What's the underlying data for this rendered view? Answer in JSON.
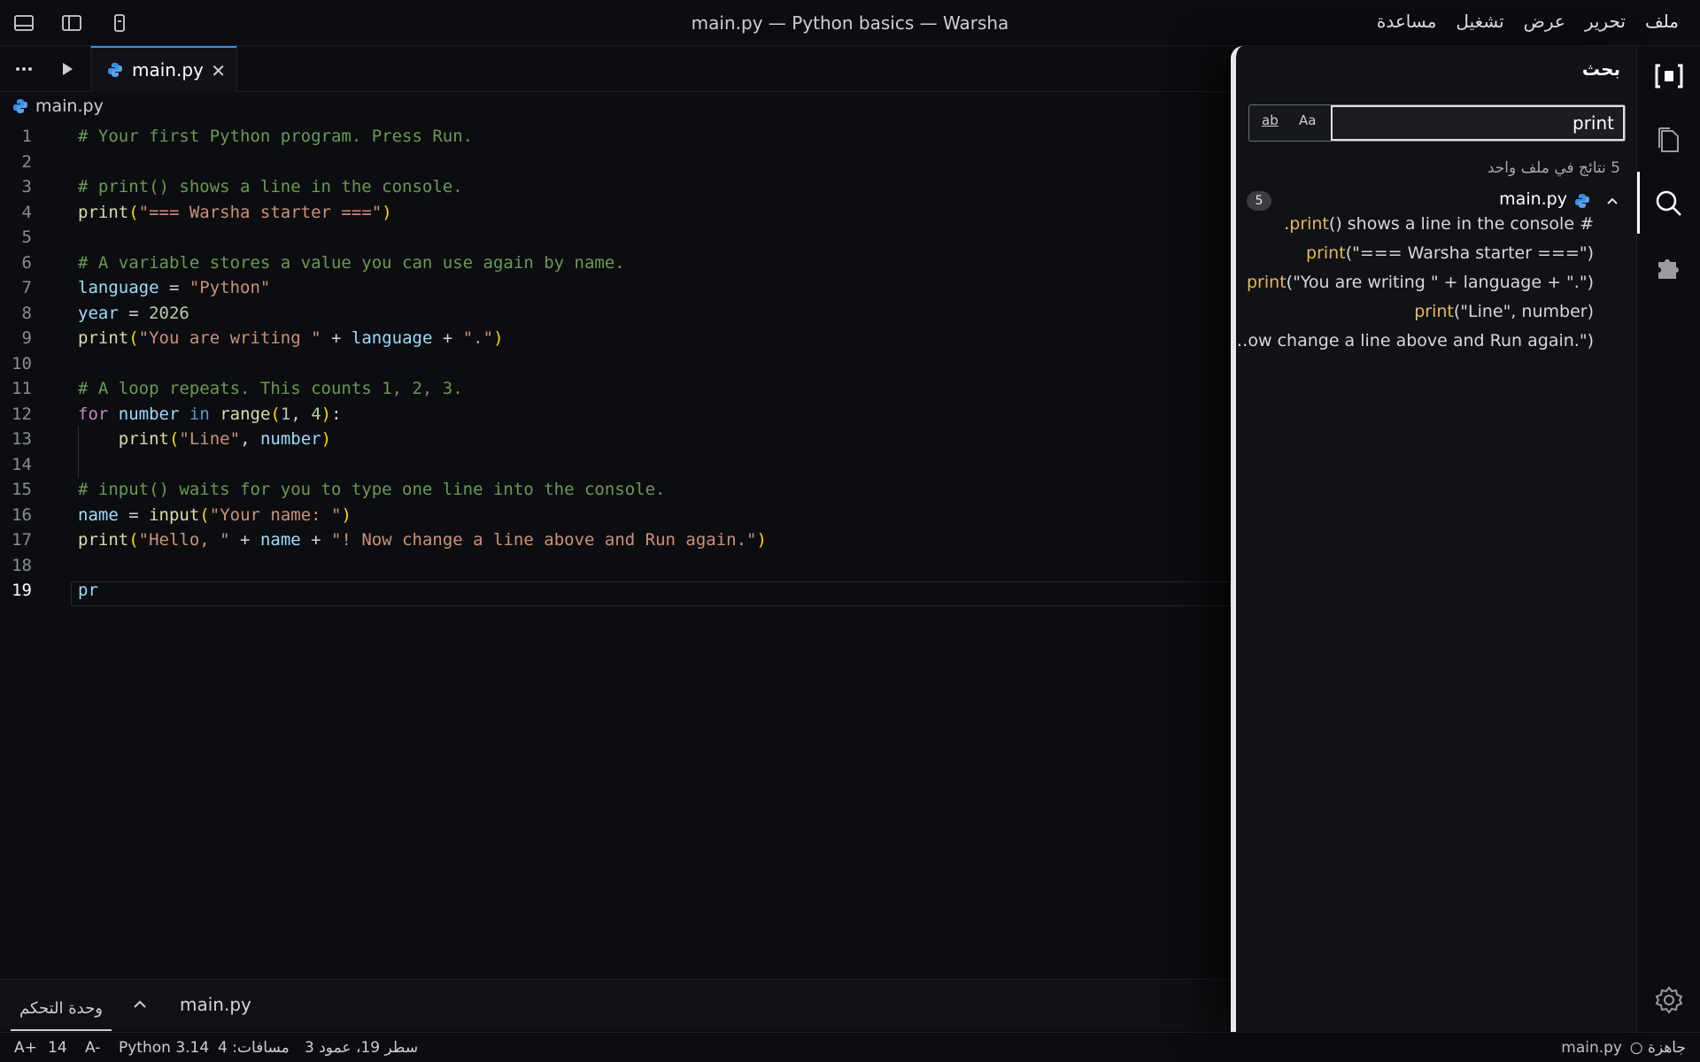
{
  "window": {
    "title": "main.py — Python basics — Warsha"
  },
  "menu": {
    "file": "ملف",
    "edit": "تحرير",
    "view": "عرض",
    "run": "تشغيل",
    "help": "مساعدة"
  },
  "tabs": {
    "active_label": "main.py",
    "close_glyph": "✕"
  },
  "breadcrumb": {
    "file": "main.py"
  },
  "editor": {
    "lines": [
      {
        "n": "1",
        "parts": [
          {
            "t": "# Your first Python program. Press Run.",
            "c": "c-com"
          }
        ]
      },
      {
        "n": "2",
        "parts": []
      },
      {
        "n": "3",
        "parts": [
          {
            "t": "# print() shows a line in the console.",
            "c": "c-com"
          }
        ]
      },
      {
        "n": "4",
        "parts": [
          {
            "t": "print",
            "c": "c-fn"
          },
          {
            "t": "(",
            "c": "c-par"
          },
          {
            "t": "\"=== Warsha starter ===\"",
            "c": "c-str"
          },
          {
            "t": ")",
            "c": "c-par"
          }
        ]
      },
      {
        "n": "5",
        "parts": []
      },
      {
        "n": "6",
        "parts": [
          {
            "t": "# A variable stores a value you can use again by name.",
            "c": "c-com"
          }
        ]
      },
      {
        "n": "7",
        "parts": [
          {
            "t": "language",
            "c": "c-var"
          },
          {
            "t": " = ",
            "c": "c-op"
          },
          {
            "t": "\"Python\"",
            "c": "c-str"
          }
        ]
      },
      {
        "n": "8",
        "parts": [
          {
            "t": "year",
            "c": "c-var"
          },
          {
            "t": " = ",
            "c": "c-op"
          },
          {
            "t": "2026",
            "c": "c-num"
          }
        ]
      },
      {
        "n": "9",
        "parts": [
          {
            "t": "print",
            "c": "c-fn"
          },
          {
            "t": "(",
            "c": "c-par"
          },
          {
            "t": "\"You are writing \"",
            "c": "c-str"
          },
          {
            "t": " + ",
            "c": "c-op"
          },
          {
            "t": "language",
            "c": "c-var"
          },
          {
            "t": " + ",
            "c": "c-op"
          },
          {
            "t": "\".\"",
            "c": "c-str"
          },
          {
            "t": ")",
            "c": "c-par"
          }
        ]
      },
      {
        "n": "10",
        "parts": []
      },
      {
        "n": "11",
        "parts": [
          {
            "t": "# A loop repeats. This counts 1, 2, 3.",
            "c": "c-com"
          }
        ]
      },
      {
        "n": "12",
        "parts": [
          {
            "t": "for",
            "c": "c-kw"
          },
          {
            "t": " ",
            "c": "c-op"
          },
          {
            "t": "number",
            "c": "c-var"
          },
          {
            "t": " ",
            "c": "c-op"
          },
          {
            "t": "in",
            "c": "c-in"
          },
          {
            "t": " ",
            "c": "c-op"
          },
          {
            "t": "range",
            "c": "c-fn"
          },
          {
            "t": "(",
            "c": "c-par"
          },
          {
            "t": "1",
            "c": "c-num"
          },
          {
            "t": ", ",
            "c": "c-op"
          },
          {
            "t": "4",
            "c": "c-num"
          },
          {
            "t": ")",
            "c": "c-par"
          },
          {
            "t": ":",
            "c": "c-op"
          }
        ]
      },
      {
        "n": "13",
        "parts": [
          {
            "t": "    ",
            "c": "c-op"
          },
          {
            "t": "print",
            "c": "c-fn"
          },
          {
            "t": "(",
            "c": "c-par"
          },
          {
            "t": "\"Line\"",
            "c": "c-str"
          },
          {
            "t": ", ",
            "c": "c-op"
          },
          {
            "t": "number",
            "c": "c-var"
          },
          {
            "t": ")",
            "c": "c-par"
          }
        ]
      },
      {
        "n": "14",
        "parts": []
      },
      {
        "n": "15",
        "parts": [
          {
            "t": "# input() waits for you to type one line into the console.",
            "c": "c-com"
          }
        ]
      },
      {
        "n": "16",
        "parts": [
          {
            "t": "name",
            "c": "c-var"
          },
          {
            "t": " = ",
            "c": "c-op"
          },
          {
            "t": "input",
            "c": "c-fn"
          },
          {
            "t": "(",
            "c": "c-par"
          },
          {
            "t": "\"Your name: \"",
            "c": "c-str"
          },
          {
            "t": ")",
            "c": "c-par"
          }
        ]
      },
      {
        "n": "17",
        "parts": [
          {
            "t": "print",
            "c": "c-fn"
          },
          {
            "t": "(",
            "c": "c-par"
          },
          {
            "t": "\"Hello, \"",
            "c": "c-str"
          },
          {
            "t": " + ",
            "c": "c-op"
          },
          {
            "t": "name",
            "c": "c-var"
          },
          {
            "t": " + ",
            "c": "c-op"
          },
          {
            "t": "\"! Now change a line above and Run again.\"",
            "c": "c-str"
          },
          {
            "t": ")",
            "c": "c-par"
          }
        ]
      },
      {
        "n": "18",
        "parts": []
      },
      {
        "n": "19",
        "parts": [
          {
            "t": "pr",
            "c": "c-var"
          }
        ]
      }
    ],
    "current_line": "19"
  },
  "panel": {
    "console_tab": "وحدة التحكم",
    "file_label": "main.py"
  },
  "search": {
    "title": "بحث",
    "query": "print",
    "whole_word_label": "ab",
    "match_case_label": "Aa",
    "summary": "5 نتائج في ملف واحد",
    "file": {
      "name": "main.py",
      "count": "5"
    },
    "results": [
      {
        "before": "",
        "match": "print",
        "after": "() shows a line in the console #",
        "prefix": "."
      },
      {
        "before": "",
        "match": "print",
        "after": "(\"=== Warsha starter ===\")",
        "prefix": ""
      },
      {
        "before": "",
        "match": "print",
        "after": "(\"You are writing \" + language + \".\")",
        "prefix": ""
      },
      {
        "before": "",
        "match": "print",
        "after": "(\"Line\", number)",
        "prefix": ""
      },
      {
        "before": "",
        "match": "",
        "after": "ow change a line above and Run again.\")",
        "prefix": "…"
      }
    ]
  },
  "status": {
    "ready": "○ جاهزة",
    "file": "main.py",
    "position": "سطر 19، عمود 3",
    "spaces": "مسافات: 4",
    "language": "Python 3.14",
    "font_decrease": "A-",
    "font_size": "14",
    "font_increase": "A+"
  },
  "colors": {
    "accent": "#3a8ee6",
    "match": "#e5b85a",
    "comment": "#6a9955",
    "string": "#ce9178"
  }
}
